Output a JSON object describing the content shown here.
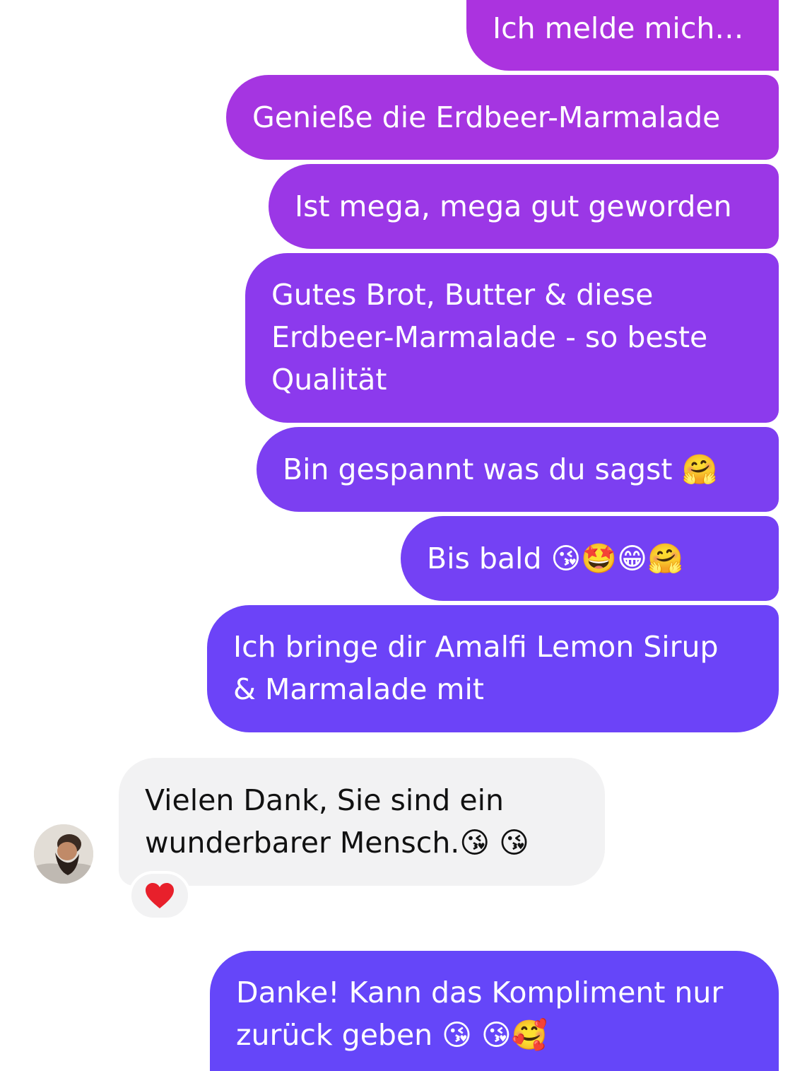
{
  "conversation": {
    "outgoing": [
      {
        "lines": [
          "Ich melde mich…"
        ]
      },
      {
        "lines": [
          "Genieße die Erdbeer-Marmalade"
        ]
      },
      {
        "lines": [
          "Ist mega, mega gut geworden"
        ]
      },
      {
        "lines": [
          "Gutes Brot, Butter & diese",
          "Erdbeer-Marmalade - so beste",
          "Qualität"
        ]
      },
      {
        "lines": [
          "Bin gespannt was du sagst 🤗"
        ]
      },
      {
        "lines": [
          "Bis bald 😘🤩😁🤗"
        ]
      },
      {
        "lines": [
          "Ich bringe dir Amalfi Lemon Sirup",
          "& Marmalade mit"
        ]
      }
    ],
    "incoming": {
      "lines": [
        "Vielen Dank, Sie sind ein",
        "wunderbarer Mensch.😘 😘"
      ],
      "reaction": "❤️",
      "avatar_icon": "bearded-man-avatar"
    },
    "reply": {
      "lines": [
        "Danke! Kann das Kompliment nur",
        "zurück geben 😘 😘🥰"
      ]
    }
  },
  "colors": {
    "outgoing_gradient_top": "#a934de",
    "outgoing_gradient_bottom": "#6b44fb",
    "incoming_bg": "#f2f2f3",
    "reaction_heart": "#e8202b"
  }
}
